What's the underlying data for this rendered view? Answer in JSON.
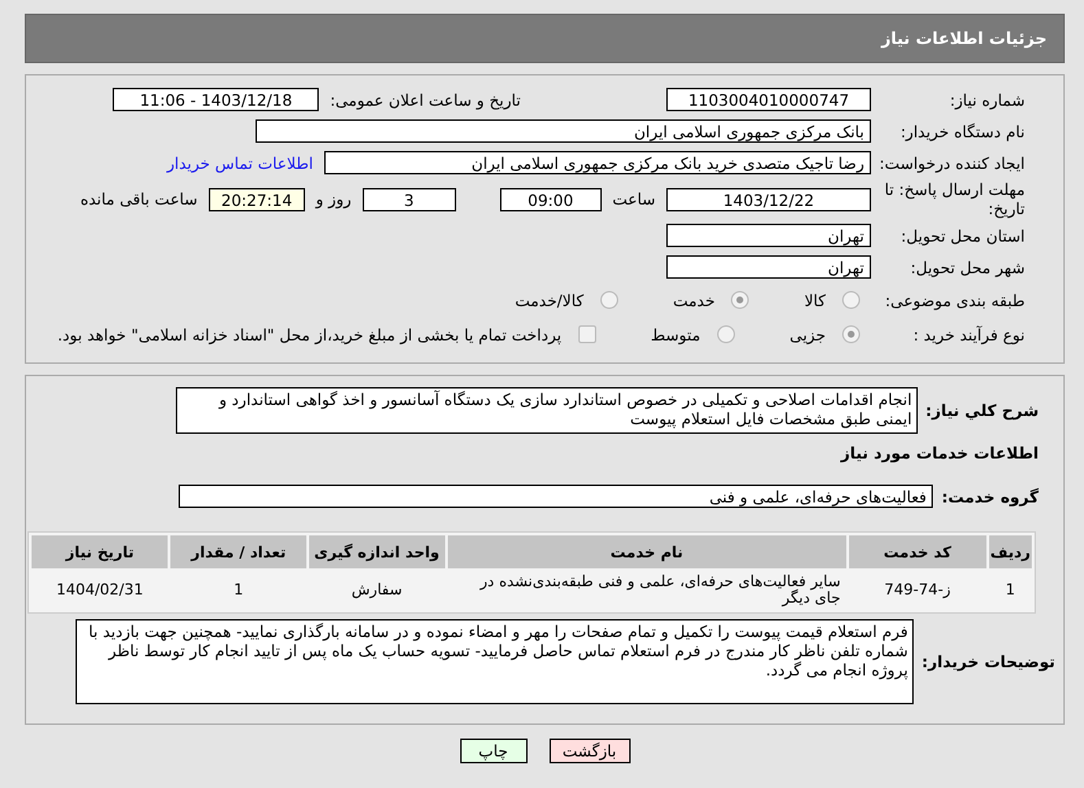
{
  "header": {
    "title": "جزئیات اطلاعات نیاز"
  },
  "need_number": {
    "label": "شماره نیاز:",
    "value": "1103004010000747"
  },
  "announce": {
    "label": "تاریخ و ساعت اعلان عمومی:",
    "value": "1403/12/18 - 11:06"
  },
  "buyer_org": {
    "label": "نام دستگاه خریدار:",
    "value": "بانک مرکزی جمهوری اسلامی ایران"
  },
  "requester": {
    "label": "ایجاد کننده درخواست:",
    "value": "رضا تاجیک متصدی خرید بانک مرکزی جمهوری اسلامی ایران",
    "link": "اطلاعات تماس خریدار"
  },
  "deadline": {
    "label": "مهلت ارسال پاسخ: تا تاریخ:",
    "date": "1403/12/22",
    "time_label": "ساعت",
    "time": "09:00",
    "days": "3",
    "days_label": "روز و",
    "remaining": "20:27:14",
    "remaining_label": "ساعت باقی مانده"
  },
  "province": {
    "label": "استان محل تحویل:",
    "value": "تهران"
  },
  "city": {
    "label": "شهر محل تحویل:",
    "value": "تهران"
  },
  "category": {
    "label": "طبقه بندی موضوعی:",
    "options": [
      {
        "label": "کالا",
        "selected": false
      },
      {
        "label": "خدمت",
        "selected": true
      },
      {
        "label": "کالا/خدمت",
        "selected": false
      }
    ]
  },
  "purchase_type": {
    "label": "نوع فرآیند خرید :",
    "options": [
      {
        "label": "جزیی",
        "selected": true
      },
      {
        "label": "متوسط",
        "selected": false
      }
    ],
    "treasury": {
      "label": "پرداخت تمام یا بخشی از مبلغ خرید،از محل \"اسناد خزانه اسلامی\" خواهد بود.",
      "checked": false
    }
  },
  "description": {
    "label": "شرح کلي نياز:",
    "value": "انجام اقدامات اصلاحی و تکمیلی در خصوص استاندارد سازی یک دستگاه آسانسور و اخذ گواهی استاندارد و ایمنی طبق مشخصات فایل استعلام پیوست"
  },
  "services_heading": "اطلاعات خدمات مورد نياز",
  "service_group": {
    "label": "گروه خدمت:",
    "value": "فعالیت‌های حرفه‌ای، علمی و فنی"
  },
  "table": {
    "columns": [
      "ردیف",
      "کد خدمت",
      "نام خدمت",
      "واحد اندازه گیری",
      "تعداد / مقدار",
      "تاریخ نیاز"
    ],
    "rows": [
      [
        "1",
        "ز-74-749",
        "سایر فعالیت‌های حرفه‌ای، علمی و فنی طبقه‌بندی‌نشده در جای دیگر",
        "سفارش",
        "1",
        "1404/02/31"
      ]
    ]
  },
  "buyer_notes": {
    "label": "توضیحات خریدار:",
    "value": "فرم استعلام قیمت پیوست را تکمیل و تمام صفحات را مهر و امضاء نموده و در سامانه بارگذاری نمایید- همچنین جهت بازدید با شماره تلفن ناظر کار مندرج در فرم استعلام تماس حاصل فرمایید- تسویه حساب یک ماه پس از تایید انجام کار توسط ناظر پروژه انجام می گردد."
  },
  "buttons": [
    {
      "label": "بازگشت",
      "kind": "back"
    },
    {
      "label": "چاپ",
      "kind": "print"
    }
  ]
}
